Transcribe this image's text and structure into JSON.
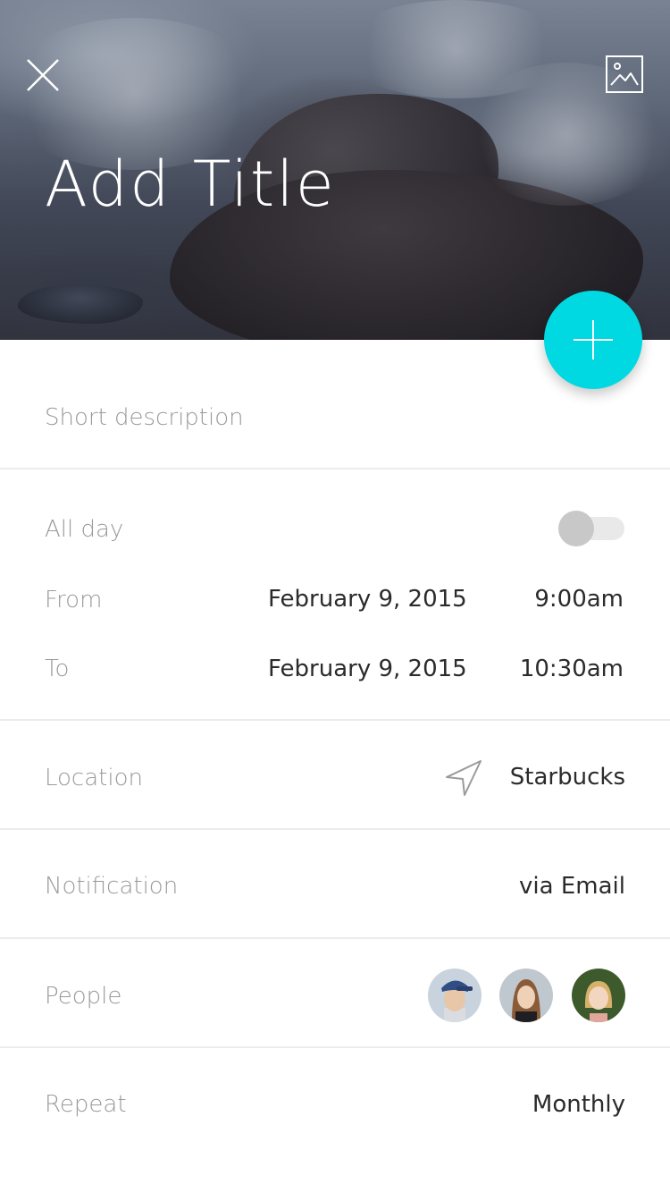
{
  "header": {
    "title": "Add Title",
    "close_icon": "close-icon",
    "image_icon": "image-icon"
  },
  "fab": {
    "icon": "plus-icon",
    "color": "#00d9e2"
  },
  "description": {
    "placeholder": "Short description"
  },
  "time": {
    "all_day_label": "All day",
    "all_day_on": false,
    "from_label": "From",
    "from_date": "February 9, 2015",
    "from_time": "9:00am",
    "to_label": "To",
    "to_date": "February 9, 2015",
    "to_time": "10:30am"
  },
  "location": {
    "label": "Location",
    "value": "Starbucks",
    "icon": "navigation-arrow-icon"
  },
  "notification": {
    "label": "Notification",
    "value": "via Email"
  },
  "people": {
    "label": "People",
    "avatars": [
      "avatar-1",
      "avatar-2",
      "avatar-3"
    ]
  },
  "repeat": {
    "label": "Repeat",
    "value": "Monthly"
  }
}
